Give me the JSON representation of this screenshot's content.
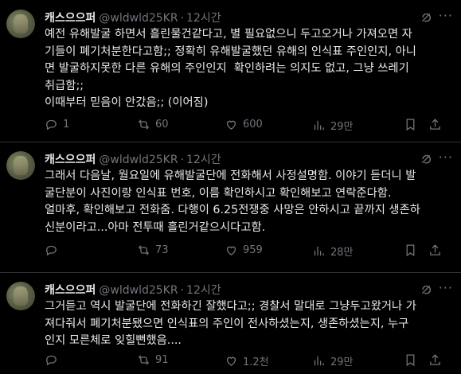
{
  "tweets": [
    {
      "name": "캐스으으퍼",
      "handle": "@wldwld25KR",
      "dot": "·",
      "time": "12시간",
      "lines": [
        "예전 유해발굴 하면서 흘린물건같다고, 별 필요없으니 두고오거나 가져오면 자",
        "기들이 폐기처분한다고함;; 정확히 유해발굴했던 유해의 인식표 주인인지, 아니",
        "면 발굴하지못한 다른 유해의 주인인지  확인하려는 의지도 없고, 그냥 쓰레기",
        "취급함;;",
        "이때부터 믿음이 안갔음;; (이어짐)"
      ],
      "replies": "1",
      "reposts": "60",
      "likes": "600",
      "views": "29만"
    },
    {
      "name": "캐스으으퍼",
      "handle": "@wldwld25KR",
      "dot": "·",
      "time": "12시간",
      "lines": [
        "그래서 다음날, 월요일에 유해발굴단에 전화해서 사정설명함. 이야기 듣더니 발",
        "굴단분이 사진이랑 인식표 번호, 이름 확인하시고 확인해보고 연락준다함.",
        "얼마후, 확인해보고 전화줌. 다행이 6.25전쟁중 사망은 안하시고 끝까지 생존하",
        "신분이라고...아마 전투때 흘린거같으시다고함."
      ],
      "replies": "",
      "reposts": "73",
      "likes": "959",
      "views": "28만"
    },
    {
      "name": "캐스으으퍼",
      "handle": "@wldwld25KR",
      "dot": "·",
      "time": "12시간",
      "lines": [
        "그거듣고 역시 발굴단에 전화하긴 잘했다고;; 경찰서 말대로 그냥두고왔거나 가",
        "져다줘서 폐기처분됐으면 인식표의 주인이 전사하셨는지, 생존하셨는지, 누구",
        "인지 모른체로 잊힐뻔했음...."
      ],
      "replies": "",
      "reposts": "91",
      "likes": "1.2천",
      "views": "29만"
    }
  ],
  "icons": {
    "grok": "grok-icon",
    "more": "more-icon",
    "reply": "reply-icon",
    "repost": "repost-icon",
    "like": "heart-icon",
    "views": "views-icon",
    "bookmark": "bookmark-icon",
    "share": "share-icon"
  },
  "more_glyph": "···",
  "colors": {
    "background": "#000000",
    "text": "#e7e9ea",
    "muted": "#71767b",
    "divider": "#2f3336"
  }
}
